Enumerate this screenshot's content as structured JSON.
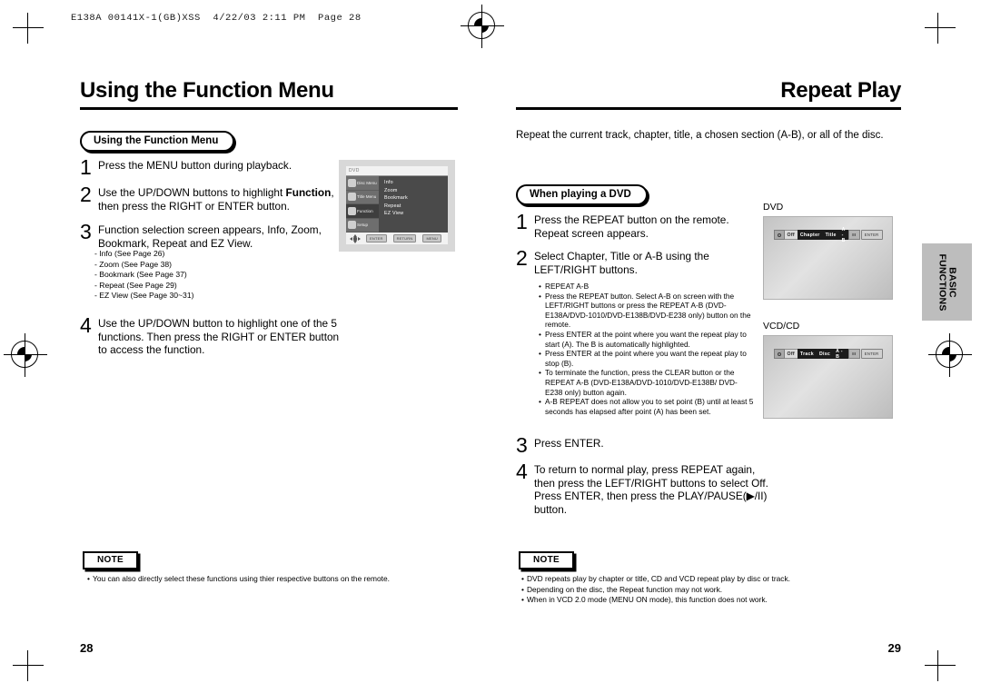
{
  "slug": "E138A 00141X-1(GB)XSS  4/22/03 2:11 PM  Page 28",
  "left_page": {
    "title": "Using the Function Menu",
    "pill": "Using the Function Menu",
    "page_number": "28",
    "steps": [
      {
        "num": "1",
        "lines": [
          "Press the MENU button during playback."
        ]
      },
      {
        "num": "2",
        "lines": [
          "Use the UP/DOWN buttons to highlight <b>Function</b>,",
          "then press the RIGHT or ENTER button."
        ]
      },
      {
        "num": "3",
        "lines": [
          "Function selection screen appears, Info, Zoom,",
          "Bookmark, Repeat and EZ View."
        ]
      },
      {
        "num": "4",
        "lines": [
          "Use the UP/DOWN button to highlight one of the 5",
          "functions. Then press the RIGHT or ENTER button",
          "to access the function."
        ]
      }
    ],
    "sublist": [
      "- Info (See Page 26)",
      "- Zoom (See Page 38)",
      "- Bookmark (See Page 37)",
      "- Repeat (See Page 29)",
      "- EZ View (See Page 30~31)"
    ],
    "tv_screen": {
      "top_label": "DVD",
      "sidebar": [
        {
          "label": "Disc Menu",
          "icon": "disc-menu-icon",
          "active": false
        },
        {
          "label": "Title Menu",
          "icon": "title-menu-icon",
          "active": false
        },
        {
          "label": "Function",
          "icon": "function-icon",
          "active": true
        },
        {
          "label": "Setup",
          "icon": "setup-gear-icon",
          "active": false
        }
      ],
      "menu_items": [
        "Info",
        "Zoom",
        "Bookmark",
        "Repeat",
        "EZ View"
      ],
      "bottom_keys": [
        "ENTER",
        "RETURN",
        "MENU"
      ]
    },
    "note": {
      "label": "NOTE",
      "items": [
        "You can also directly select these functions using thier respective buttons on the remote."
      ]
    }
  },
  "right_page": {
    "title": "Repeat Play",
    "intro": "Repeat the current track, chapter, title, a chosen section (A-B), or all of the disc.",
    "pill": "When playing a DVD",
    "page_number": "29",
    "steps": [
      {
        "num": "1",
        "lines": [
          "Press the REPEAT button on the remote.",
          "Repeat screen appears."
        ]
      },
      {
        "num": "2",
        "lines": [
          "Select Chapter, Title or A-B using the",
          "LEFT/RIGHT buttons."
        ]
      },
      {
        "num": "3",
        "lines": [
          "Press ENTER."
        ]
      },
      {
        "num": "4",
        "lines": [
          "To return to normal play, press REPEAT again,",
          "then press the LEFT/RIGHT buttons to select Off.",
          "Press ENTER, then press the PLAY/PAUSE( ▶/II)",
          "button."
        ]
      }
    ],
    "fine_list": [
      "REPEAT A-B",
      "Press the REPEAT button. Select A-B on screen with the LEFT/RIGHT buttons or press the REPEAT A-B (DVD-E138A/DVD-1010/DVD-E138B/DVD-E238 only) button on the remote.",
      "Press ENTER at the point where you want the repeat play to start (A). The B is automatically highlighted.",
      "Press ENTER at the point where you want the repeat play to stop (B).",
      "To terminate the function, press the CLEAR button or the REPEAT A-B (DVD-E138A/DVD-1010/DVD-E138B/ DVD-E238 only) button again.",
      "A-B REPEAT does not allow you to set point (B) until at least 5 seconds has elapsed after point (A) has been set."
    ],
    "screens": [
      {
        "label": "DVD",
        "icon": "repeat-loop-icon",
        "off": "Off",
        "options": [
          "Chapter",
          "Title",
          "A - B"
        ],
        "end_key": "ⅡⅡ",
        "enter_key": "ENTER"
      },
      {
        "label": "VCD/CD",
        "icon": "repeat-loop-icon",
        "off": "Off",
        "options": [
          "Track",
          "Disc",
          "A - B"
        ],
        "end_key": "ⅡⅡ",
        "enter_key": "ENTER"
      }
    ],
    "side_tab": "BASIC\nFUNCTIONS",
    "note": {
      "label": "NOTE",
      "items": [
        "DVD repeats play by chapter or title, CD and VCD repeat play by disc or track.",
        "Depending on the disc, the Repeat function may not work.",
        "When in VCD 2.0 mode (MENU ON mode), this function does not work."
      ]
    }
  }
}
